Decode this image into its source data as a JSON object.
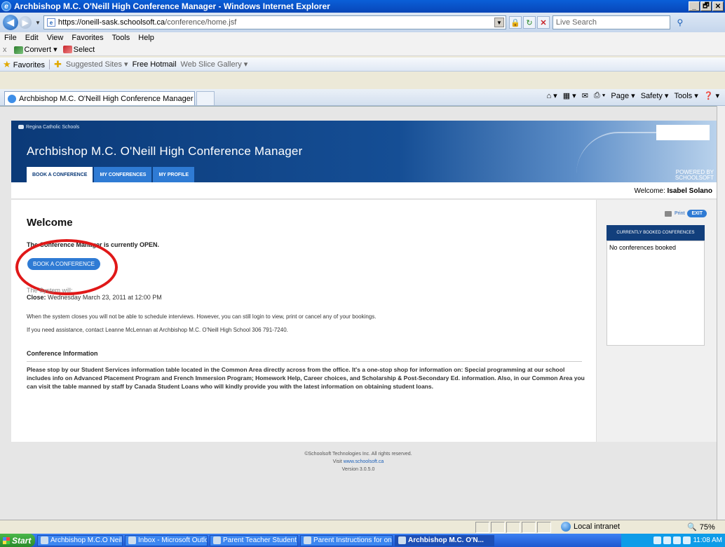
{
  "window": {
    "title": "Archbishop M.C. O'Neill High Conference Manager - Windows Internet Explorer",
    "controls": [
      "_",
      "🗗",
      "✕"
    ]
  },
  "address": {
    "url_domain": "https://oneill-sask.schoolsoft.ca",
    "url_path": "/conference/home.jsf",
    "search_placeholder": "Live Search"
  },
  "menu": [
    "File",
    "Edit",
    "View",
    "Favorites",
    "Tools",
    "Help"
  ],
  "commands": {
    "close_glyph": "x",
    "convert": "Convert",
    "select": "Select"
  },
  "favorites": {
    "label": "Favorites",
    "items": [
      "Suggested Sites ▾",
      "Free Hotmail",
      "Web Slice Gallery ▾"
    ]
  },
  "tab": {
    "label": "Archbishop M.C. O'Neill High Conference Manager"
  },
  "toolbar_right": [
    "Page ▾",
    "Safety ▾",
    "Tools ▾"
  ],
  "site": {
    "org": "Regina Catholic Schools",
    "title": "Archbishop M.C. O'Neill High Conference Manager",
    "powered_by": "POWERED BY",
    "brand": "SCHOOLSOFT",
    "tabs": [
      "BOOK A CONFERENCE",
      "MY CONFERENCES",
      "MY PROFILE"
    ],
    "welcome_label": "Welcome:",
    "user_name": "Isabel Solano"
  },
  "content": {
    "heading": "Welcome",
    "open_msg": "The Conference Manager is currently OPEN.",
    "book_button": "BOOK A CONFERENCE",
    "system_will": "The System will:",
    "close_label": "Close:",
    "close_date": "Wednesday March 23, 2011 at 12:00 PM",
    "p1": "When the system closes you will not be able to schedule interviews. However, you can still login to view, print or cancel any of your bookings.",
    "p2": "If you need assistance, contact Leanne McLennan at Archbishop M.C. O'Neill High School 306 791-7240.",
    "info_heading": "Conference Information",
    "info_text": "Please stop by our Student Services information table located in the Common Area directly across from the office. It's a one-stop shop for information on: Special programming at our school includes info on Advanced Placement Program and French Immersion Program; Homework Help, Career choices, and Scholarship & Post-Secondary Ed. information. Also, in our Common Area you can visit the table manned by staff by Canada Student Loans who will kindly provide you with the latest information on obtaining student loans."
  },
  "sidebar": {
    "print": "Print",
    "exit": "EXIT",
    "booked_header": "CURRENTLY BOOKED CONFERENCES",
    "booked_empty": "No conferences booked"
  },
  "footer": {
    "copyright": "©Schoolsoft Technologies Inc. All rights reserved.",
    "visit": "Visit",
    "link": "www.schoolsoft.ca",
    "version": "Version 3.0.5.0"
  },
  "status": {
    "zone": "Local intranet",
    "zoom": "75%"
  },
  "taskbar": {
    "start": "Start",
    "tasks": [
      "Archbishop M.C.O Neill Hi...",
      "Inbox - Microsoft Outlook",
      "Parent Teacher Student ...",
      "Parent Instructions for on-l...",
      "Archbishop M.C. O'N..."
    ],
    "clock": "11:08 AM"
  }
}
